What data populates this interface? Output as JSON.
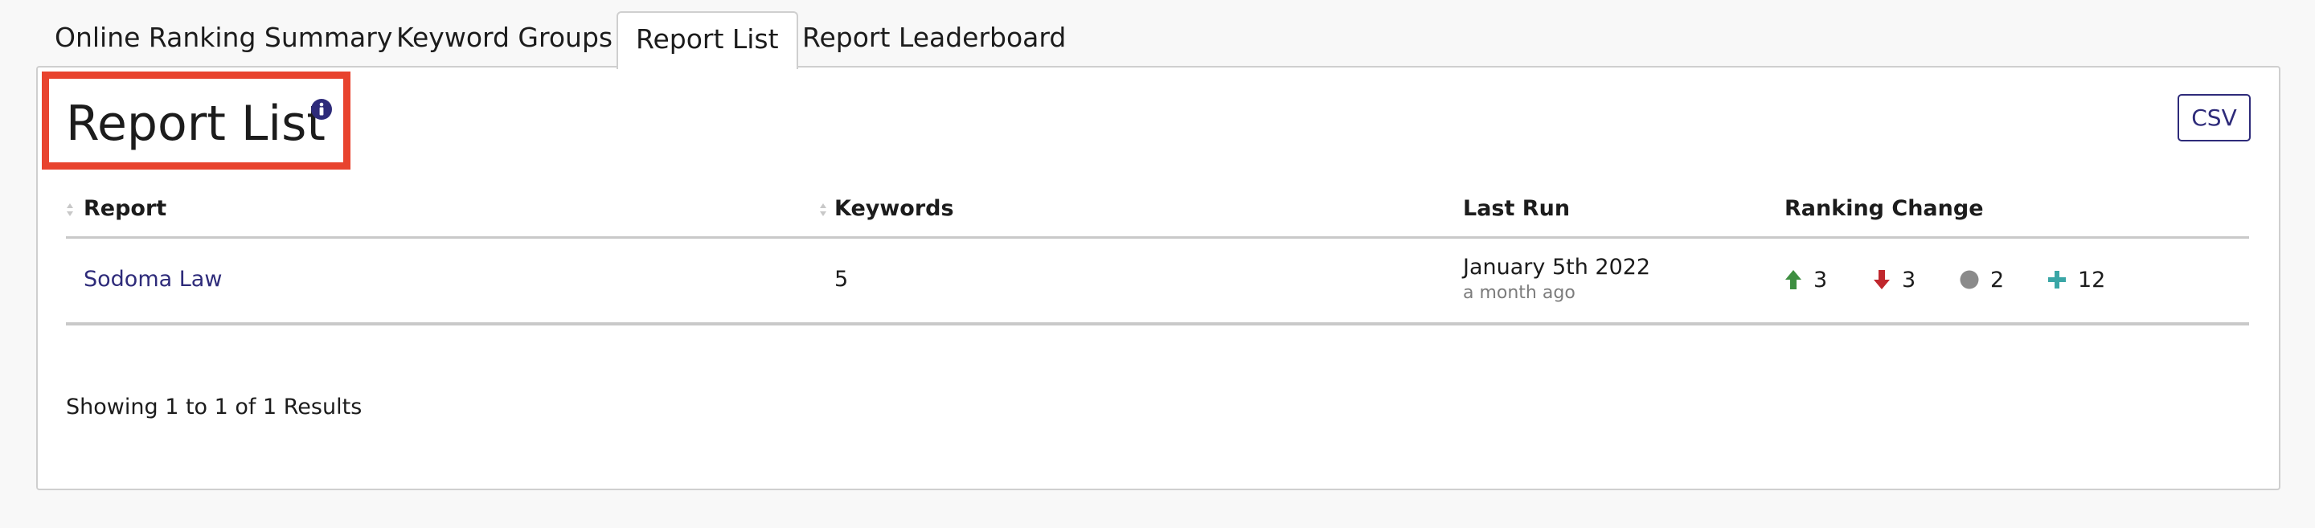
{
  "tabs": [
    {
      "label": "Online Ranking Summary",
      "active": false
    },
    {
      "label": "Keyword Groups",
      "active": false
    },
    {
      "label": "Report List",
      "active": true
    },
    {
      "label": "Report Leaderboard",
      "active": false
    }
  ],
  "header": {
    "title": "Report List",
    "info_icon": "info-circle-icon",
    "csv_label": "CSV"
  },
  "table": {
    "columns": [
      "Report",
      "Keywords",
      "Last Run",
      "Ranking Change"
    ],
    "rows": [
      {
        "report": "Sodoma Law",
        "keywords": "5",
        "last_run": "January 5th 2022",
        "last_run_relative": "a month ago",
        "ranking_change": {
          "up": "3",
          "down": "3",
          "unchanged": "2",
          "new": "12"
        }
      }
    ]
  },
  "footer": {
    "results_text": "Showing 1 to 1 of 1 Results"
  },
  "colors": {
    "accent": "#2e2b7a",
    "highlight_box": "#e8432e",
    "up": "#3e8e41",
    "down": "#c0272d",
    "unchanged": "#8a8a8a",
    "new": "#3aa6a6"
  }
}
